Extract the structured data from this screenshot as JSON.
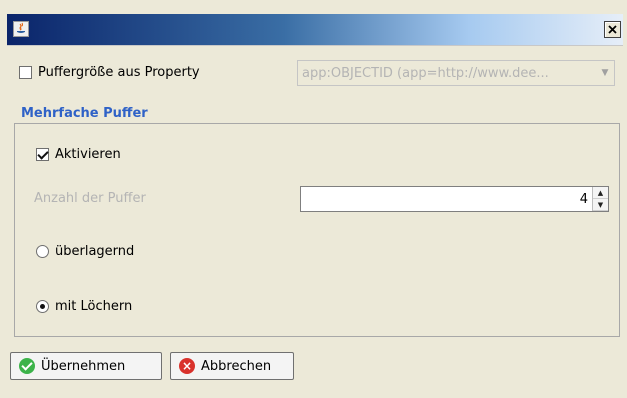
{
  "window": {
    "close_glyph": "×"
  },
  "buffer_size_checkbox": {
    "label": "Puffergröße aus Property",
    "checked": false
  },
  "property_combo": {
    "value": "app:OBJECTID (app=http://www.dee...",
    "arrow": "▼"
  },
  "group": {
    "title": "Mehrfache Puffer",
    "activate": {
      "label": "Aktivieren",
      "checked": true
    },
    "count_label": "Anzahl der Puffer",
    "count_value": "4",
    "spinner_up": "▲",
    "spinner_down": "▼",
    "radio_overlapping": {
      "label": "überlagernd",
      "selected": false
    },
    "radio_holes": {
      "label": "mit Löchern",
      "selected": true
    }
  },
  "buttons": {
    "apply": "Übernehmen",
    "cancel": "Abbrechen",
    "cancel_icon_glyph": "×"
  },
  "colors": {
    "group_title": "#2f62c7",
    "titlebar_start": "#0a246a",
    "background": "#ece9d8"
  }
}
